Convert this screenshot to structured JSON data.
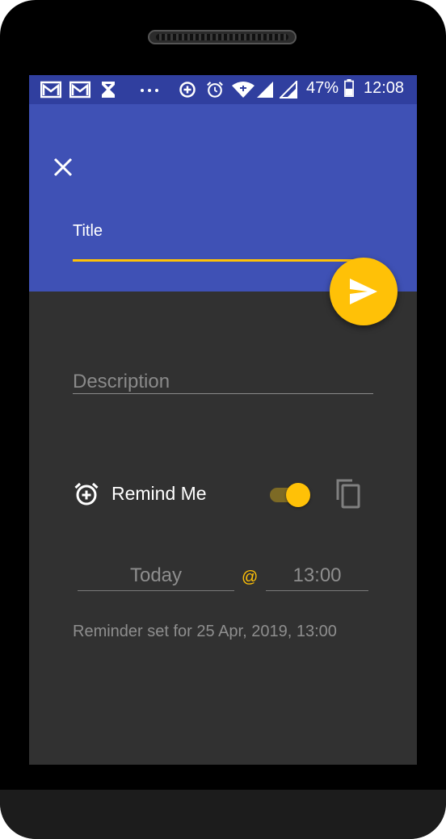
{
  "status_bar": {
    "battery_percent": "47%",
    "time": "12:08",
    "icons": [
      "gmail-icon",
      "gmail-icon",
      "hourglass-icon",
      "more-dots-icon",
      "data-saver-icon",
      "alarm-icon",
      "wifi-icon",
      "signal-icon",
      "signal-icon",
      "battery-icon"
    ]
  },
  "header": {
    "title_label": "Title"
  },
  "form": {
    "description_placeholder": "Description",
    "remind_label": "Remind Me",
    "remind_enabled": true,
    "date": "Today",
    "at_symbol": "@",
    "time": "13:00",
    "reminder_summary": "Reminder set for 25 Apr, 2019, 13:00"
  },
  "colors": {
    "primary": "#3f51b5",
    "primary_dark": "#303f9f",
    "accent": "#ffc107",
    "background": "#313131"
  }
}
